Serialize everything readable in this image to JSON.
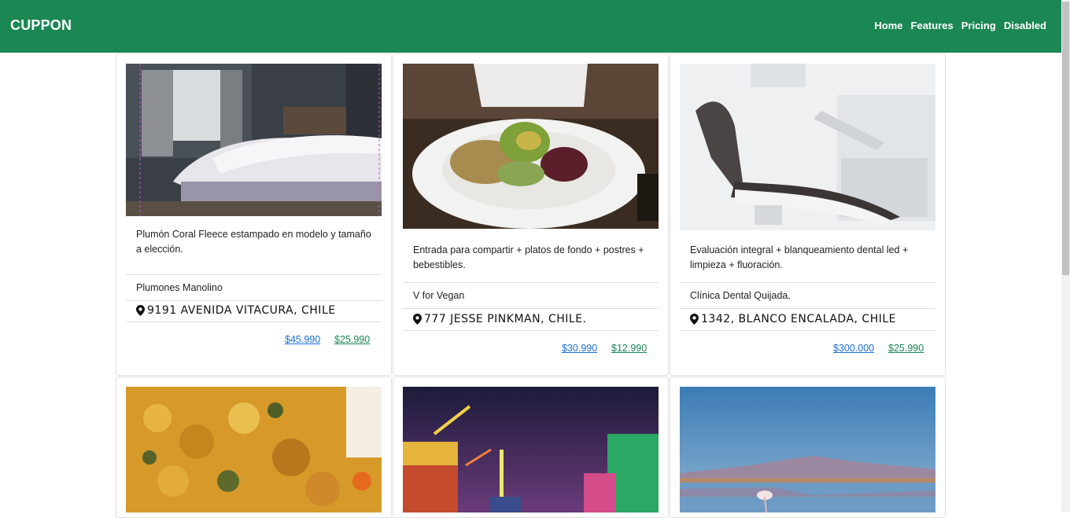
{
  "navbar": {
    "brand": "CUPPON",
    "links": [
      "Home",
      "Features",
      "Pricing",
      "Disabled"
    ]
  },
  "cards": [
    {
      "description": "Plumón Coral Fleece estampado en modelo y tamaño a elección.",
      "vendor": "Plumones Manolino",
      "address": "9191 AVENIDA VITACURA, CHILE",
      "price_old": "$45.990",
      "price_new": "$25.990"
    },
    {
      "description": "Entrada para compartir + platos de fondo + postres + bebestibles.",
      "vendor": "V for Vegan",
      "address": "777 JESSE PINKMAN, CHILE.",
      "price_old": "$30.990",
      "price_new": "$12.990"
    },
    {
      "description": "Evaluación integral + blanqueamiento dental led + limpieza + fluoración.",
      "vendor": "Clínica Dental Quijada.",
      "address": "1342, BLANCO ENCALADA, CHILE",
      "price_old": "$300.000",
      "price_new": "$25.990"
    }
  ],
  "colors": {
    "navbar": "#1b8753",
    "old_price": "#1a6fd6",
    "new_price": "#1b8753"
  }
}
